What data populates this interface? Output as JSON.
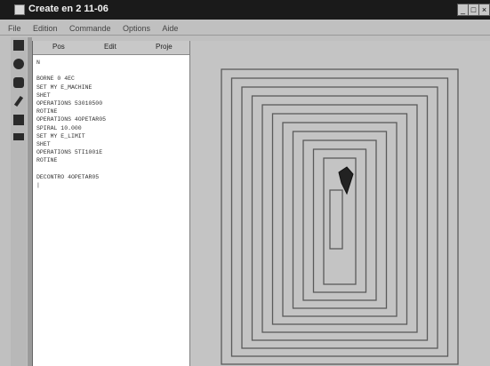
{
  "window": {
    "title": "Create en 2 11-06"
  },
  "menu": [
    "File",
    "Edition",
    "Commande",
    "Options",
    "Aide"
  ],
  "panel_tabs": [
    "Pos",
    "Edit",
    "Proje"
  ],
  "code_lines": [
    "N",
    "",
    "BORNE 0 4EC",
    "SET MY E_MACHINE",
    "SHET",
    "OPERATIONS 53010500",
    "ROTINE",
    "OPERATIONS 4OPETAR05",
    "SPIRAL 10.000",
    "SET MY E_LIMIT",
    "SHET",
    "OPERATIONS 5TI1001E",
    "ROTINE",
    "",
    "DECONTRO 4OPETAR05",
    "|"
  ],
  "toolbar_icons": [
    "save-icon",
    "circle-icon",
    "gear-icon",
    "pencil-icon",
    "grid-icon",
    "sign-icon"
  ],
  "spiral": {
    "line_color": "#5a5a5a",
    "rings": 11
  }
}
